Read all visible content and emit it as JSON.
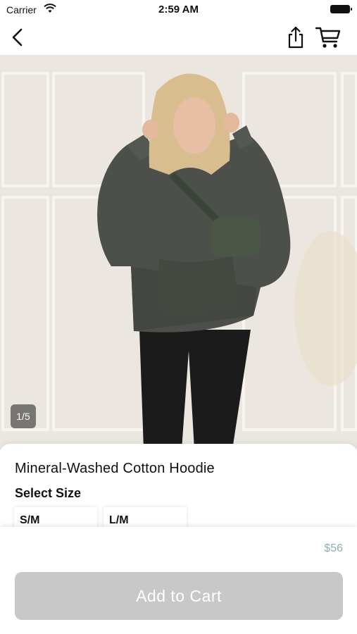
{
  "status_bar": {
    "carrier": "Carrier",
    "time": "2:59 AM"
  },
  "nav": {
    "back_icon": "chevron-left-icon",
    "share_icon": "share-icon",
    "cart_icon": "cart-icon"
  },
  "gallery": {
    "counter": "1/5"
  },
  "product": {
    "title": "Mineral-Washed Cotton Hoodie",
    "size_heading": "Select Size",
    "sizes": [
      "S/M",
      "L/M"
    ],
    "price": "$56"
  },
  "actions": {
    "add_to_cart_label": "Add to Cart"
  },
  "colors": {
    "price": "#8fb0ac",
    "button_disabled": "#c8c8c8"
  }
}
